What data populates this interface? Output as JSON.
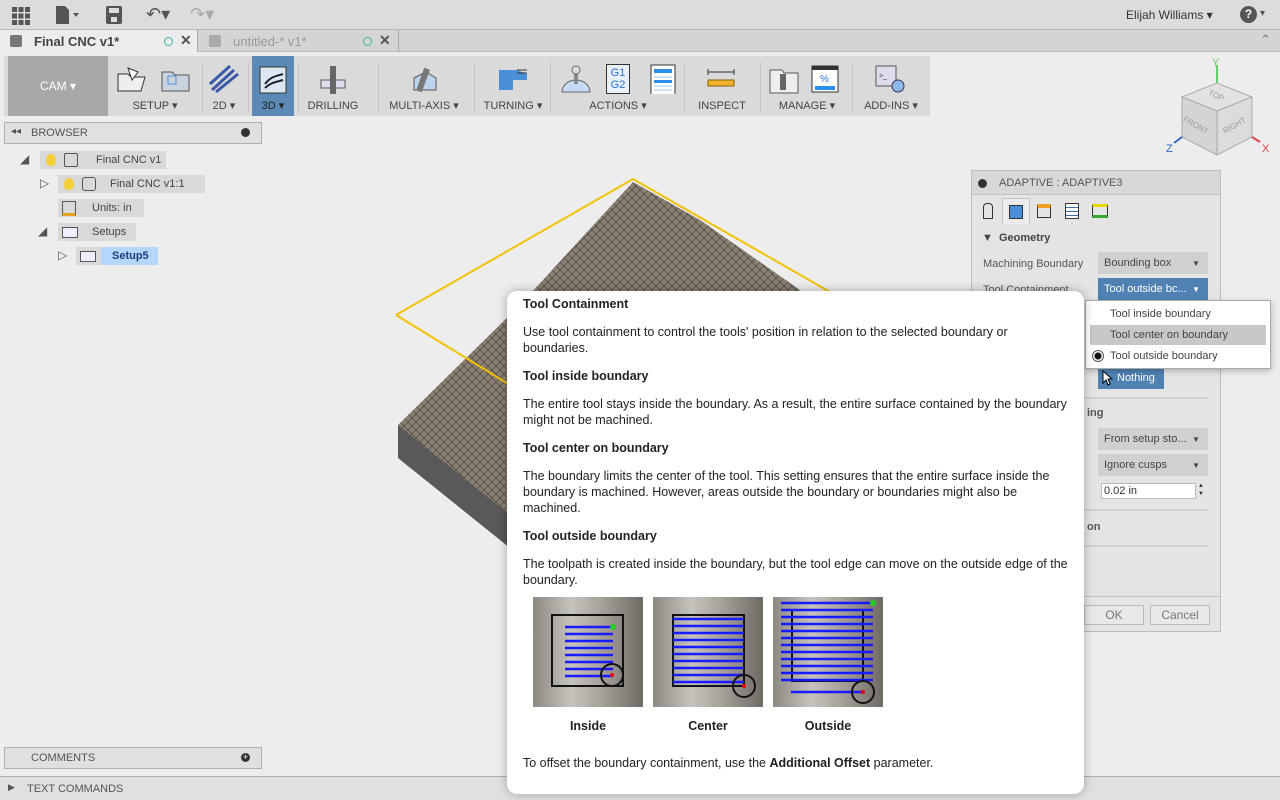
{
  "app": {
    "user": "Elijah Williams",
    "help_icon": "help-icon"
  },
  "tabs": [
    {
      "label": "Final CNC v1*",
      "active": true
    },
    {
      "label": "untitled-* v1*",
      "active": false
    }
  ],
  "toolbar": {
    "workspace": "CAM",
    "groups": [
      {
        "label": "SETUP",
        "dropdown": true
      },
      {
        "label": "2D",
        "dropdown": true
      },
      {
        "label": "3D",
        "dropdown": true,
        "active": true
      },
      {
        "label": "DRILLING",
        "dropdown": false
      },
      {
        "label": "MULTI-AXIS",
        "dropdown": true
      },
      {
        "label": "TURNING",
        "dropdown": true
      },
      {
        "label": "ACTIONS",
        "dropdown": true
      },
      {
        "label": "INSPECT",
        "dropdown": false
      },
      {
        "label": "MANAGE",
        "dropdown": true
      },
      {
        "label": "ADD-INS",
        "dropdown": true
      }
    ],
    "gcode_icon_text": [
      "G1",
      "G2"
    ]
  },
  "viewcube": {
    "faces": [
      "TOP",
      "FRONT",
      "RIGHT"
    ],
    "axes": [
      "X",
      "Y",
      "Z"
    ]
  },
  "browser": {
    "title": "BROWSER",
    "items": [
      {
        "label": "Final CNC v1"
      },
      {
        "label": "Final CNC v1:1"
      },
      {
        "label": "Units: in"
      },
      {
        "label": "Setups"
      },
      {
        "label": "Setup5",
        "selected": true
      }
    ]
  },
  "comments": {
    "title": "COMMENTS"
  },
  "text_commands": {
    "title": "TEXT COMMANDS"
  },
  "panel": {
    "title": "ADAPTIVE : ADAPTIVE3",
    "section": "Geometry",
    "machining_boundary_label": "Machining Boundary",
    "machining_boundary_value": "Bounding box",
    "tool_containment_label": "Tool Containment",
    "tool_containment_value": "Tool outside bc...",
    "selection_value": "Nothing",
    "section2_partial": "ing",
    "stock_value": "From setup sto...",
    "cusps_value": "Ignore cusps",
    "offset_value": "0.02 in",
    "section3_partial": "on",
    "ok": "OK",
    "cancel": "Cancel"
  },
  "dropdown": {
    "options": [
      "Tool inside boundary",
      "Tool center on boundary",
      "Tool outside boundary"
    ],
    "selected": "Tool outside boundary",
    "hovered": "Tool center on boundary"
  },
  "tooltip": {
    "title": "Tool Containment",
    "intro": "Use tool containment to control the tools' position in relation to the selected boundary or boundaries.",
    "sections": [
      {
        "heading": "Tool inside boundary",
        "text": "The entire tool stays inside the boundary. As a result, the entire surface contained by the boundary might not be machined."
      },
      {
        "heading": "Tool center on boundary",
        "text": "The boundary limits the center of the tool. This setting ensures that the entire surface inside the boundary is machined. However, areas outside the boundary or boundaries might also be machined."
      },
      {
        "heading": "Tool outside boundary",
        "text": "The toolpath is created inside the boundary, but the tool edge can move on the outside edge of the boundary."
      }
    ],
    "images": [
      "Inside",
      "Center",
      "Outside"
    ],
    "footer_pre": "To offset the boundary containment, use the ",
    "footer_bold": "Additional Offset",
    "footer_post": " parameter."
  },
  "colors": {
    "accent": "#4f82b3",
    "boundary": "#f2c200",
    "selected": "#b5d5fb"
  }
}
